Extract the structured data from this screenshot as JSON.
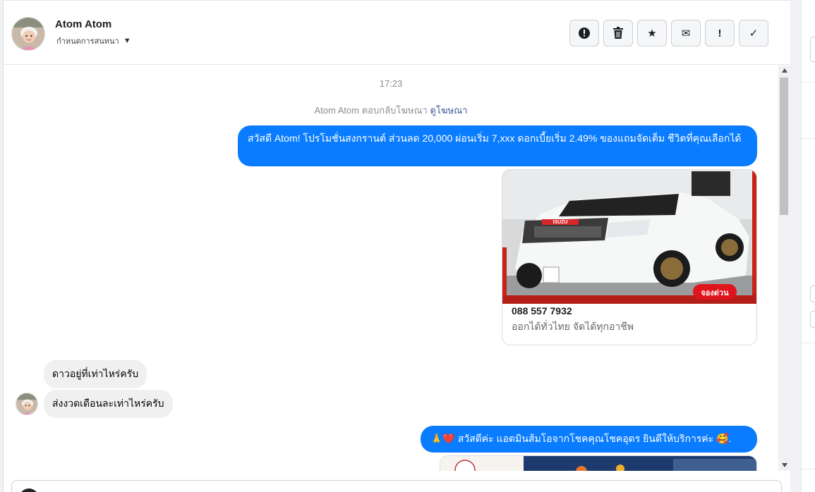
{
  "header": {
    "contact_name": "Atom Atom",
    "assign_label": "กำหนดการสนทนา",
    "toolbar": [
      {
        "icon": "alert-circle-icon",
        "glyph": "!"
      },
      {
        "icon": "trash-icon",
        "glyph": ""
      },
      {
        "icon": "star-icon",
        "glyph": "★"
      },
      {
        "icon": "mail-icon",
        "glyph": "✉"
      },
      {
        "icon": "exclamation-icon",
        "glyph": "!"
      },
      {
        "icon": "check-icon",
        "glyph": "✓"
      }
    ]
  },
  "conversation": {
    "timestamp": "17:23",
    "ad_reply_prefix": "Atom Atom ตอบกลับโฆษณา",
    "ad_reply_link": "ดูโฆษณา",
    "outgoing_1": "สวัสดี Atom! โปรโมชั่นสงกรานต์ ส่วนลด 20,000 ผ่อนเริ่ม 7,xxx ดอกเบี้ยเริ่ม 2.49% ของแถมจัดเต็ม ชีวิตที่คุณเลือกได้",
    "ad_card": {
      "badge": "จองด่วน",
      "brand": "ISUZU",
      "title": "088 557 7932",
      "subtitle": "ออกได้ทั่วไทย จัดได้ทุกอาชีพ"
    },
    "incoming_1": "ดาวอยู่ที่เท่าไหร่ครับ",
    "incoming_2": "ส่งงวดเดือนละเท่าไหร่ครับ",
    "outgoing_2": "🙏❤️ สวัสดีค่ะ แอดมินส้มโอจากโชคคุณโชคอุดร ยินดีให้บริการค่ะ 🥰."
  },
  "colors": {
    "outgoing_bubble": "#0a7cff",
    "incoming_bubble": "#f0f0f0",
    "link": "#385898"
  }
}
